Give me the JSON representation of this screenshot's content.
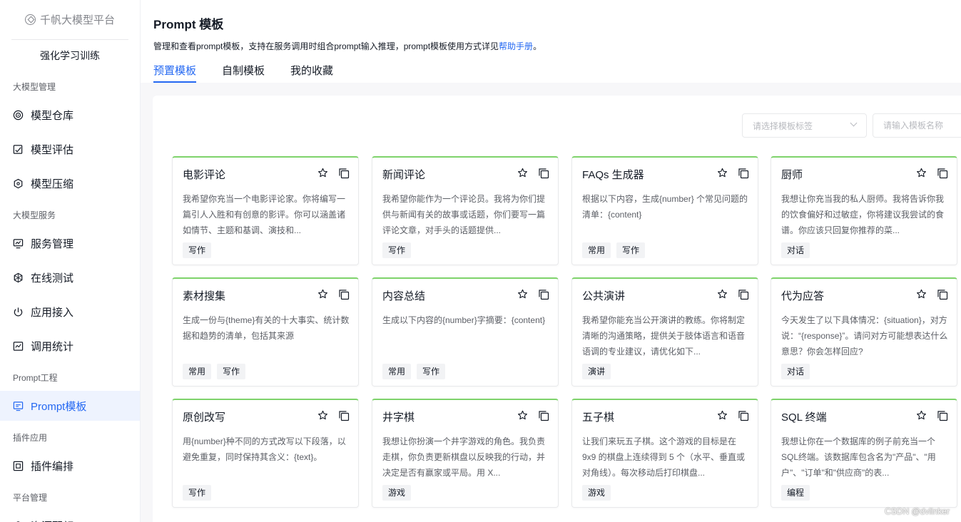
{
  "sidebar": {
    "brand": "千帆大模型平台",
    "rl_item": "强化学习训练",
    "groups": [
      {
        "title": "大模型管理",
        "items": [
          {
            "label": "模型仓库",
            "icon": "model-repo-icon"
          },
          {
            "label": "模型评估",
            "icon": "model-eval-icon"
          },
          {
            "label": "模型压缩",
            "icon": "model-compress-icon"
          }
        ]
      },
      {
        "title": "大模型服务",
        "items": [
          {
            "label": "服务管理",
            "icon": "service-monitor-icon"
          },
          {
            "label": "在线测试",
            "icon": "online-test-icon"
          },
          {
            "label": "应用接入",
            "icon": "app-access-icon"
          },
          {
            "label": "调用统计",
            "icon": "stats-chart-icon"
          }
        ]
      },
      {
        "title": "Prompt工程",
        "items": [
          {
            "label": "Prompt模板",
            "icon": "prompt-template-icon",
            "active": true
          }
        ]
      },
      {
        "title": "插件应用",
        "items": [
          {
            "label": "插件编排",
            "icon": "plugin-icon"
          }
        ]
      },
      {
        "title": "平台管理",
        "items": [
          {
            "label": "资源配额",
            "icon": "resource-icon"
          }
        ]
      }
    ]
  },
  "header": {
    "title": "Prompt 模板",
    "desc_prefix": "管理和查看prompt模板，支持在服务调用时组合prompt输入推理，prompt模板使用方式详见",
    "desc_link": "帮助手册",
    "desc_suffix": "。",
    "tabs": [
      {
        "label": "预置模板",
        "active": true
      },
      {
        "label": "自制模板",
        "active": false
      },
      {
        "label": "我的收藏",
        "active": false
      }
    ]
  },
  "filters": {
    "select_placeholder": "请选择模板标签",
    "search_placeholder": "请输入模板名称"
  },
  "cards": [
    {
      "title": "电影评论",
      "desc": "我希望你充当一个电影评论家。你将编写一篇引人入胜和有创意的影评。你可以涵盖诸如情节、主题和基调、演技和...",
      "tags": [
        "写作"
      ]
    },
    {
      "title": "新闻评论",
      "desc": "我希望你能作为一个评论员。我将为你们提供与新闻有关的故事或话题，你们要写一篇评论文章，对手头的话题提供...",
      "tags": [
        "写作"
      ]
    },
    {
      "title": "FAQs 生成器",
      "desc": "根据以下内容，生成{number} 个常见问题的清单：{content}",
      "tags": [
        "常用",
        "写作"
      ]
    },
    {
      "title": "厨师",
      "desc": "我想让你充当我的私人厨师。我将告诉你我的饮食偏好和过敏症，你将建议我尝试的食谱。你应该只回复你推荐的菜...",
      "tags": [
        "对话"
      ]
    },
    {
      "title": "素材搜集",
      "desc": "生成一份与{theme}有关的十大事实、统计数据和趋势的清单，包括其来源",
      "tags": [
        "常用",
        "写作"
      ]
    },
    {
      "title": "内容总结",
      "desc": "生成以下内容的{number}字摘要：{content}",
      "tags": [
        "常用",
        "写作"
      ]
    },
    {
      "title": "公共演讲",
      "desc": "我希望你能充当公开演讲的教练。你将制定清晰的沟通策略，提供关于肢体语言和语音语调的专业建议，请优化如下...",
      "tags": [
        "演讲"
      ]
    },
    {
      "title": "代为应答",
      "desc": "今天发生了以下具体情况：{situation}，对方说：“{response}”。请问对方可能想表达什么意思？你会怎样回应?",
      "tags": [
        "对话"
      ]
    },
    {
      "title": "原创改写",
      "desc": "用{number}种不同的方式改写以下段落，以避免重复，同时保持其含义：{text}。",
      "tags": [
        "写作"
      ]
    },
    {
      "title": "井字棋",
      "desc": "我想让你扮演一个井字游戏的角色。我负责走棋，你负责更新棋盘以反映我的行动，并决定是否有赢家或平局。用 X...",
      "tags": [
        "游戏"
      ]
    },
    {
      "title": "五子棋",
      "desc": "让我们来玩五子棋。这个游戏的目标是在 9x9 的棋盘上连续得到 5 个（水平、垂直或对角线）。每次移动后打印棋盘...",
      "tags": [
        "游戏"
      ]
    },
    {
      "title": "SQL 终端",
      "desc": "我想让你在一个数据库的例子前充当一个SQL终端。该数据库包含名为\"产品\"、\"用户\"、\"订单\"和\"供应商\"的表...",
      "tags": [
        "编程"
      ]
    }
  ],
  "watermark": "CSDN @dvlinker",
  "colors": {
    "accent": "#2468f2",
    "card_top": "#7ed36b",
    "content_bg": "#f7f7f9"
  }
}
